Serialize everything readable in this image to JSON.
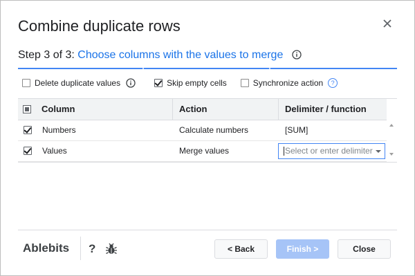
{
  "dialog": {
    "title": "Combine duplicate rows"
  },
  "step": {
    "prefix": "Step 3 of 3:",
    "text": "Choose columns with the values to merge"
  },
  "options": {
    "delete_duplicates": {
      "label": "Delete duplicate values",
      "checked": false
    },
    "skip_empty": {
      "label": "Skip empty cells",
      "checked": true
    },
    "synchronize": {
      "label": "Synchronize action",
      "checked": false
    }
  },
  "table": {
    "headers": [
      "Column",
      "Action",
      "Delimiter / function"
    ],
    "rows": [
      {
        "checked": true,
        "column": "Numbers",
        "action": "Calculate numbers",
        "delimiter": "[SUM]"
      },
      {
        "checked": true,
        "column": "Values",
        "action": "Merge values",
        "delimiter_placeholder": "Select or enter delimiter"
      }
    ]
  },
  "footer": {
    "brand": "Ablebits",
    "help": "?",
    "back_label": "< Back",
    "finish_label": "Finish >",
    "close_label": "Close"
  },
  "colors": {
    "link": "#1a73e8",
    "finish_disabled": "#a6c4f7",
    "focus_border": "#4285f4"
  },
  "icons": [
    "close-icon",
    "info-icon",
    "help-circle-icon",
    "checkbox-icon",
    "caret-down-icon",
    "scroll-up-icon",
    "scroll-down-icon",
    "bug-icon"
  ]
}
